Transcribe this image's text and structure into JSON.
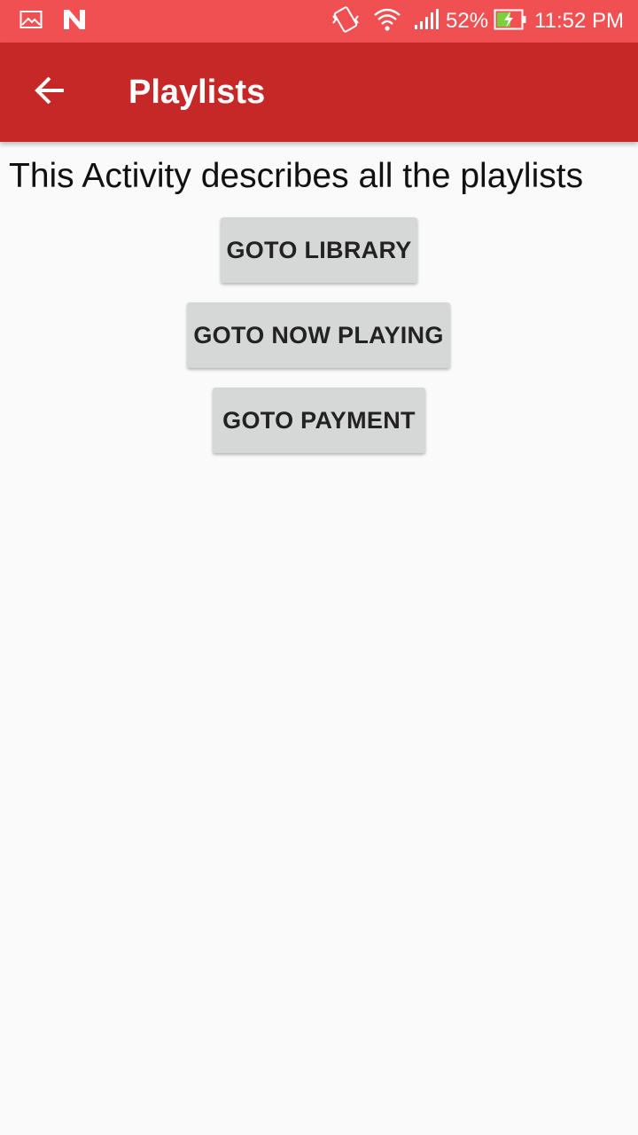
{
  "status_bar": {
    "battery_percent": "52%",
    "time": "11:52 PM",
    "icons": [
      "image-notification-icon",
      "n-notification-icon",
      "vibrate-icon",
      "wifi-icon",
      "signal-icon",
      "battery-charging-icon"
    ]
  },
  "app_bar": {
    "title": "Playlists",
    "back_icon": "arrow-back-icon"
  },
  "main": {
    "description": "This Activity describes all the playlists",
    "buttons": [
      {
        "label": "GOTO LIBRARY"
      },
      {
        "label": "GOTO NOW PLAYING"
      },
      {
        "label": "GOTO PAYMENT"
      }
    ]
  },
  "colors": {
    "status_bar": "#f05052",
    "app_bar": "#c62828",
    "background": "#fafafa",
    "button": "#d6d7d7"
  }
}
